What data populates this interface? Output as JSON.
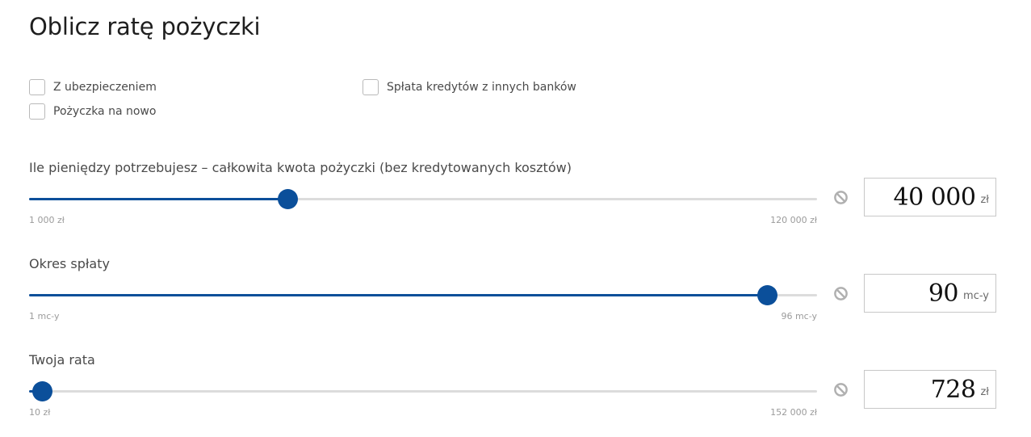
{
  "title": "Oblicz ratę pożyczki",
  "options": {
    "insurance": {
      "label": "Z ubezpieczeniem",
      "checked": false
    },
    "renew": {
      "label": "Pożyczka na nowo",
      "checked": false
    },
    "consolidation": {
      "label": "Spłata kredytów z innych banków",
      "checked": false
    }
  },
  "amount": {
    "label": "Ile pieniędzy potrzebujesz – całkowita kwota pożyczki (bez kredytowanych kosztów)",
    "min_label": "1 000 zł",
    "max_label": "120 000 zł",
    "min": 1000,
    "max": 120000,
    "value": 40000,
    "value_display": "40 000",
    "unit": "zł"
  },
  "period": {
    "label": "Okres spłaty",
    "min_label": "1 mc-y",
    "max_label": "96 mc-y",
    "min": 1,
    "max": 96,
    "value": 90,
    "value_display": "90",
    "unit": "mc-y"
  },
  "installment": {
    "label": "Twoja rata",
    "min_label": "10 zł",
    "max_label": "152 000 zł",
    "min": 10,
    "max": 152000,
    "value": 728,
    "value_display": "728",
    "unit": "zł"
  },
  "colors": {
    "accent": "#0b4f9a",
    "track": "#dcdcdc"
  },
  "icons": {
    "reset": "block-icon"
  }
}
